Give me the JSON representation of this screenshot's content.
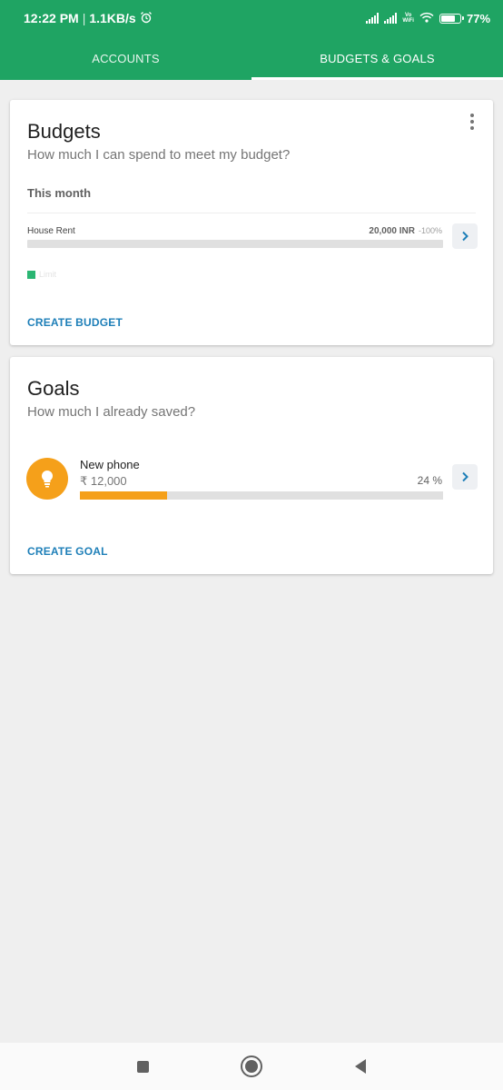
{
  "status": {
    "time": "12:22 PM",
    "speed": "1.1KB/s",
    "vowifi_top": "Vo",
    "vowifi_bottom": "WiFi",
    "battery_pct": "77",
    "battery_level": 0.77,
    "battery_suffix": "%"
  },
  "tabs": [
    {
      "label": "ACCOUNTS",
      "active": false
    },
    {
      "label": "BUDGETS & GOALS",
      "active": true
    }
  ],
  "budgets": {
    "title": "Budgets",
    "subtitle": "How much I can spend to meet my budget?",
    "period": "This month",
    "items": [
      {
        "name": "House Rent",
        "amount": "20,000 INR",
        "percent": "-100%",
        "progress": 0
      }
    ],
    "legend_label": "Limit",
    "create_label": "CREATE BUDGET"
  },
  "goals": {
    "title": "Goals",
    "subtitle": "How much I already saved?",
    "items": [
      {
        "name": "New phone",
        "amount": "₹ 12,000",
        "percent": "24 %",
        "progress": 0.24,
        "icon": "lightbulb-icon"
      }
    ],
    "create_label": "CREATE GOAL"
  },
  "colors": {
    "primary": "#1fa463",
    "link": "#1e7fb8",
    "goal_accent": "#f5a01a",
    "legend": "#2bb673"
  }
}
